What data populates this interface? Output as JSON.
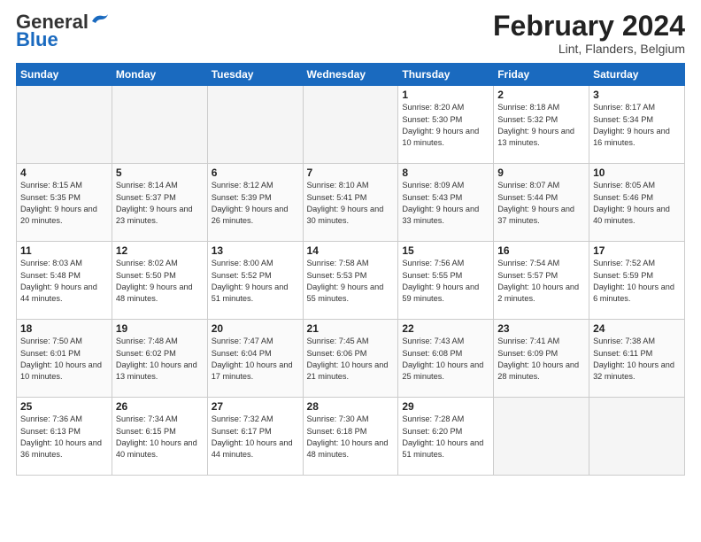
{
  "header": {
    "logo_general": "General",
    "logo_blue": "Blue",
    "month_year": "February 2024",
    "location": "Lint, Flanders, Belgium"
  },
  "days_of_week": [
    "Sunday",
    "Monday",
    "Tuesday",
    "Wednesday",
    "Thursday",
    "Friday",
    "Saturday"
  ],
  "weeks": [
    [
      {
        "date": "",
        "sunrise": "",
        "sunset": "",
        "daylight": ""
      },
      {
        "date": "",
        "sunrise": "",
        "sunset": "",
        "daylight": ""
      },
      {
        "date": "",
        "sunrise": "",
        "sunset": "",
        "daylight": ""
      },
      {
        "date": "",
        "sunrise": "",
        "sunset": "",
        "daylight": ""
      },
      {
        "date": "1",
        "sunrise": "Sunrise: 8:20 AM",
        "sunset": "Sunset: 5:30 PM",
        "daylight": "Daylight: 9 hours and 10 minutes."
      },
      {
        "date": "2",
        "sunrise": "Sunrise: 8:18 AM",
        "sunset": "Sunset: 5:32 PM",
        "daylight": "Daylight: 9 hours and 13 minutes."
      },
      {
        "date": "3",
        "sunrise": "Sunrise: 8:17 AM",
        "sunset": "Sunset: 5:34 PM",
        "daylight": "Daylight: 9 hours and 16 minutes."
      }
    ],
    [
      {
        "date": "4",
        "sunrise": "Sunrise: 8:15 AM",
        "sunset": "Sunset: 5:35 PM",
        "daylight": "Daylight: 9 hours and 20 minutes."
      },
      {
        "date": "5",
        "sunrise": "Sunrise: 8:14 AM",
        "sunset": "Sunset: 5:37 PM",
        "daylight": "Daylight: 9 hours and 23 minutes."
      },
      {
        "date": "6",
        "sunrise": "Sunrise: 8:12 AM",
        "sunset": "Sunset: 5:39 PM",
        "daylight": "Daylight: 9 hours and 26 minutes."
      },
      {
        "date": "7",
        "sunrise": "Sunrise: 8:10 AM",
        "sunset": "Sunset: 5:41 PM",
        "daylight": "Daylight: 9 hours and 30 minutes."
      },
      {
        "date": "8",
        "sunrise": "Sunrise: 8:09 AM",
        "sunset": "Sunset: 5:43 PM",
        "daylight": "Daylight: 9 hours and 33 minutes."
      },
      {
        "date": "9",
        "sunrise": "Sunrise: 8:07 AM",
        "sunset": "Sunset: 5:44 PM",
        "daylight": "Daylight: 9 hours and 37 minutes."
      },
      {
        "date": "10",
        "sunrise": "Sunrise: 8:05 AM",
        "sunset": "Sunset: 5:46 PM",
        "daylight": "Daylight: 9 hours and 40 minutes."
      }
    ],
    [
      {
        "date": "11",
        "sunrise": "Sunrise: 8:03 AM",
        "sunset": "Sunset: 5:48 PM",
        "daylight": "Daylight: 9 hours and 44 minutes."
      },
      {
        "date": "12",
        "sunrise": "Sunrise: 8:02 AM",
        "sunset": "Sunset: 5:50 PM",
        "daylight": "Daylight: 9 hours and 48 minutes."
      },
      {
        "date": "13",
        "sunrise": "Sunrise: 8:00 AM",
        "sunset": "Sunset: 5:52 PM",
        "daylight": "Daylight: 9 hours and 51 minutes."
      },
      {
        "date": "14",
        "sunrise": "Sunrise: 7:58 AM",
        "sunset": "Sunset: 5:53 PM",
        "daylight": "Daylight: 9 hours and 55 minutes."
      },
      {
        "date": "15",
        "sunrise": "Sunrise: 7:56 AM",
        "sunset": "Sunset: 5:55 PM",
        "daylight": "Daylight: 9 hours and 59 minutes."
      },
      {
        "date": "16",
        "sunrise": "Sunrise: 7:54 AM",
        "sunset": "Sunset: 5:57 PM",
        "daylight": "Daylight: 10 hours and 2 minutes."
      },
      {
        "date": "17",
        "sunrise": "Sunrise: 7:52 AM",
        "sunset": "Sunset: 5:59 PM",
        "daylight": "Daylight: 10 hours and 6 minutes."
      }
    ],
    [
      {
        "date": "18",
        "sunrise": "Sunrise: 7:50 AM",
        "sunset": "Sunset: 6:01 PM",
        "daylight": "Daylight: 10 hours and 10 minutes."
      },
      {
        "date": "19",
        "sunrise": "Sunrise: 7:48 AM",
        "sunset": "Sunset: 6:02 PM",
        "daylight": "Daylight: 10 hours and 13 minutes."
      },
      {
        "date": "20",
        "sunrise": "Sunrise: 7:47 AM",
        "sunset": "Sunset: 6:04 PM",
        "daylight": "Daylight: 10 hours and 17 minutes."
      },
      {
        "date": "21",
        "sunrise": "Sunrise: 7:45 AM",
        "sunset": "Sunset: 6:06 PM",
        "daylight": "Daylight: 10 hours and 21 minutes."
      },
      {
        "date": "22",
        "sunrise": "Sunrise: 7:43 AM",
        "sunset": "Sunset: 6:08 PM",
        "daylight": "Daylight: 10 hours and 25 minutes."
      },
      {
        "date": "23",
        "sunrise": "Sunrise: 7:41 AM",
        "sunset": "Sunset: 6:09 PM",
        "daylight": "Daylight: 10 hours and 28 minutes."
      },
      {
        "date": "24",
        "sunrise": "Sunrise: 7:38 AM",
        "sunset": "Sunset: 6:11 PM",
        "daylight": "Daylight: 10 hours and 32 minutes."
      }
    ],
    [
      {
        "date": "25",
        "sunrise": "Sunrise: 7:36 AM",
        "sunset": "Sunset: 6:13 PM",
        "daylight": "Daylight: 10 hours and 36 minutes."
      },
      {
        "date": "26",
        "sunrise": "Sunrise: 7:34 AM",
        "sunset": "Sunset: 6:15 PM",
        "daylight": "Daylight: 10 hours and 40 minutes."
      },
      {
        "date": "27",
        "sunrise": "Sunrise: 7:32 AM",
        "sunset": "Sunset: 6:17 PM",
        "daylight": "Daylight: 10 hours and 44 minutes."
      },
      {
        "date": "28",
        "sunrise": "Sunrise: 7:30 AM",
        "sunset": "Sunset: 6:18 PM",
        "daylight": "Daylight: 10 hours and 48 minutes."
      },
      {
        "date": "29",
        "sunrise": "Sunrise: 7:28 AM",
        "sunset": "Sunset: 6:20 PM",
        "daylight": "Daylight: 10 hours and 51 minutes."
      },
      {
        "date": "",
        "sunrise": "",
        "sunset": "",
        "daylight": ""
      },
      {
        "date": "",
        "sunrise": "",
        "sunset": "",
        "daylight": ""
      }
    ]
  ]
}
